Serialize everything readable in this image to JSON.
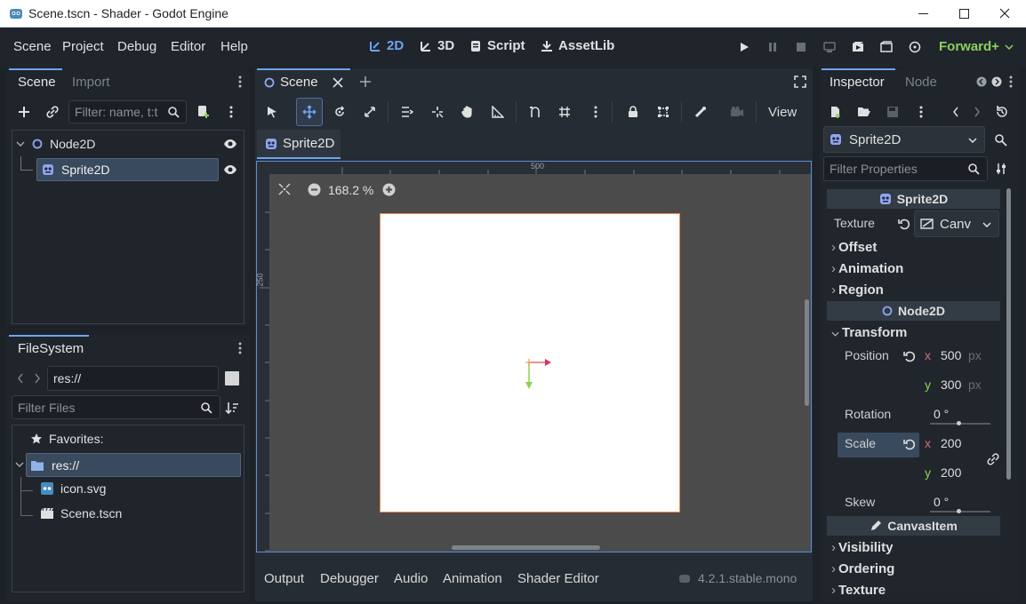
{
  "window": {
    "title": "Scene.tscn - Shader - Godot Engine"
  },
  "menu": {
    "items": [
      "Scene",
      "Project",
      "Debug",
      "Editor",
      "Help"
    ]
  },
  "workspaces": {
    "w2d": "2D",
    "w3d": "3D",
    "script": "Script",
    "assetlib": "AssetLib"
  },
  "renderer": "Forward+",
  "scene_dock": {
    "tabs": [
      "Scene",
      "Import"
    ],
    "filter_placeholder": "Filter: name, t:t",
    "tree": [
      {
        "label": "Node2D"
      },
      {
        "label": "Sprite2D",
        "selected": true
      }
    ]
  },
  "filesystem": {
    "title": "FileSystem",
    "path": "res://",
    "filter_placeholder": "Filter Files",
    "favorites": "Favorites:",
    "items": [
      "res://",
      "icon.svg",
      "Scene.tscn"
    ]
  },
  "editor": {
    "scene_tab": "Scene",
    "subtab": "Sprite2D",
    "view_menu": "View",
    "zoom": "168.2 %",
    "ruler_h": "500",
    "ruler_v": "250"
  },
  "bottom_panel": {
    "tabs": [
      "Output",
      "Debugger",
      "Audio",
      "Animation",
      "Shader Editor"
    ],
    "version": "4.2.1.stable.mono"
  },
  "inspector": {
    "tabs": [
      "Inspector",
      "Node"
    ],
    "node_select": "Sprite2D",
    "filter_placeholder": "Filter Properties",
    "sprite_section": "Sprite2D",
    "texture_label": "Texture",
    "texture_value": "Canv",
    "groups1": [
      "Offset",
      "Animation",
      "Region"
    ],
    "node2d_section": "Node2D",
    "transform_group": "Transform",
    "position_label": "Position",
    "position": {
      "x": "500",
      "y": "300",
      "unit": "px"
    },
    "rotation_label": "Rotation",
    "rotation_value": "0 °",
    "scale_label": "Scale",
    "scale": {
      "x": "200",
      "y": "200"
    },
    "skew_label": "Skew",
    "skew_value": "0 °",
    "canvasitem_section": "CanvasItem",
    "groups2": [
      "Visibility",
      "Ordering",
      "Texture"
    ]
  },
  "colors": {
    "accent": "#6ea4f0",
    "axis_x": "#e06a72",
    "axis_y": "#8ed34e",
    "canvas_bg": "#4b4b4b",
    "sprite_border": "#f08a4a"
  }
}
